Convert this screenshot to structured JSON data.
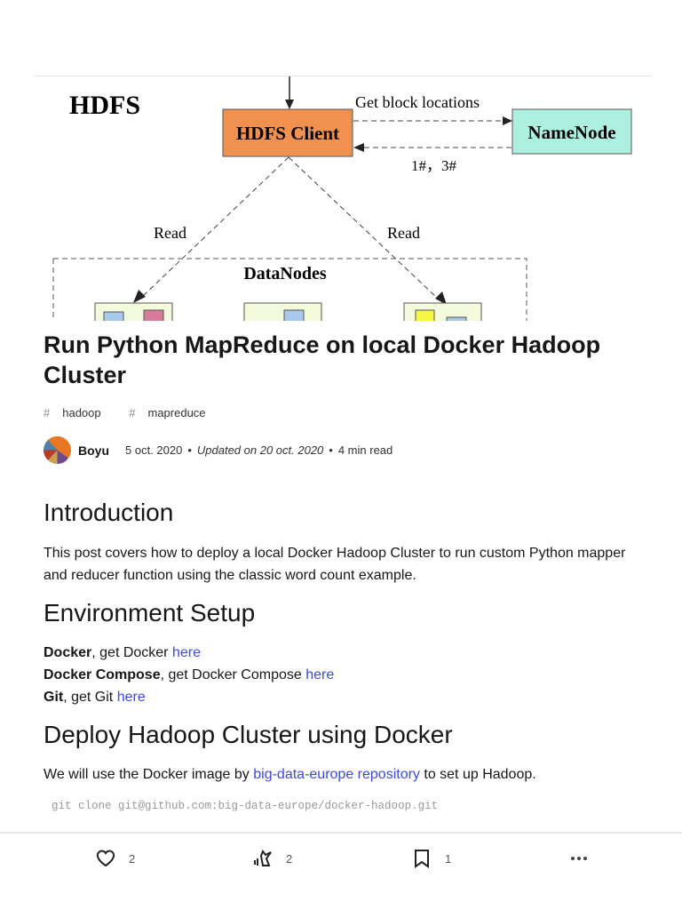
{
  "cover": {
    "heading": "HDFS",
    "client": "HDFS Client",
    "namenode": "NameNode",
    "request": "Get block locations",
    "response": "1#，3#",
    "read_left": "Read",
    "read_right": "Read",
    "datanodes": "DataNodes"
  },
  "article": {
    "title": "Run Python MapReduce on local Docker Hadoop Cluster",
    "tags": [
      "hadoop",
      "mapreduce"
    ],
    "author": "Boyu",
    "published": "5 oct. 2020",
    "updated": "Updated on 20 oct. 2020",
    "read_time": "4 min read"
  },
  "intro": {
    "heading": "Introduction",
    "text": "This post covers how to deploy a local Docker Hadoop Cluster to run custom Python mapper and reducer function using the classic word count example."
  },
  "env": {
    "heading": "Environment Setup",
    "items": [
      {
        "name": "Docker",
        "text": ", get Docker ",
        "link": "here"
      },
      {
        "name": "Docker Compose",
        "text": ", get Docker Compose ",
        "link": "here"
      },
      {
        "name": "Git",
        "text": ", get Git ",
        "link": "here"
      }
    ]
  },
  "deploy": {
    "heading": "Deploy Hadoop Cluster using Docker",
    "pre": "We will use the Docker image by ",
    "link": "big-data-europe repository",
    "post": " to set up Hadoop.",
    "code": "git clone git@github.com:big-data-europe/docker-hadoop.git"
  },
  "actions": {
    "likes": "2",
    "unicorns": "2",
    "bookmarks": "1"
  }
}
